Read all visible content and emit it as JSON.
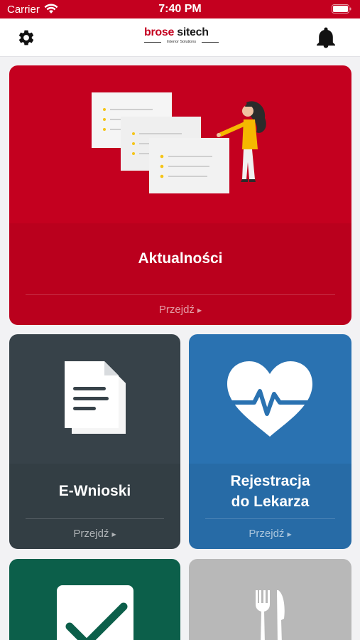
{
  "status_bar": {
    "carrier": "Carrier",
    "time": "7:40 PM"
  },
  "header": {
    "logo_brand_part1": "brose",
    "logo_brand_part2": "sitech",
    "logo_tagline": "Interior Solutions",
    "settings_icon": "gear-icon",
    "notification_icon": "bell-icon"
  },
  "tiles": [
    {
      "id": "news",
      "title": "Aktualności",
      "cta": "Przejdź",
      "icon": "news-illustration",
      "color": "#c4001f"
    },
    {
      "id": "forms",
      "title": "E-Wnioski",
      "cta": "Przejdź",
      "icon": "document-icon",
      "color": "#374249"
    },
    {
      "id": "doctor",
      "title_line1": "Rejestracja",
      "title_line2": "do Lekarza",
      "cta": "Przejdź",
      "icon": "heart-pulse-icon",
      "color": "#2a72b1"
    },
    {
      "id": "tasks",
      "icon": "checkmark-icon",
      "color": "#0c5f4a"
    },
    {
      "id": "food",
      "icon": "fork-knife-icon",
      "color": "#b8b8b8"
    }
  ]
}
